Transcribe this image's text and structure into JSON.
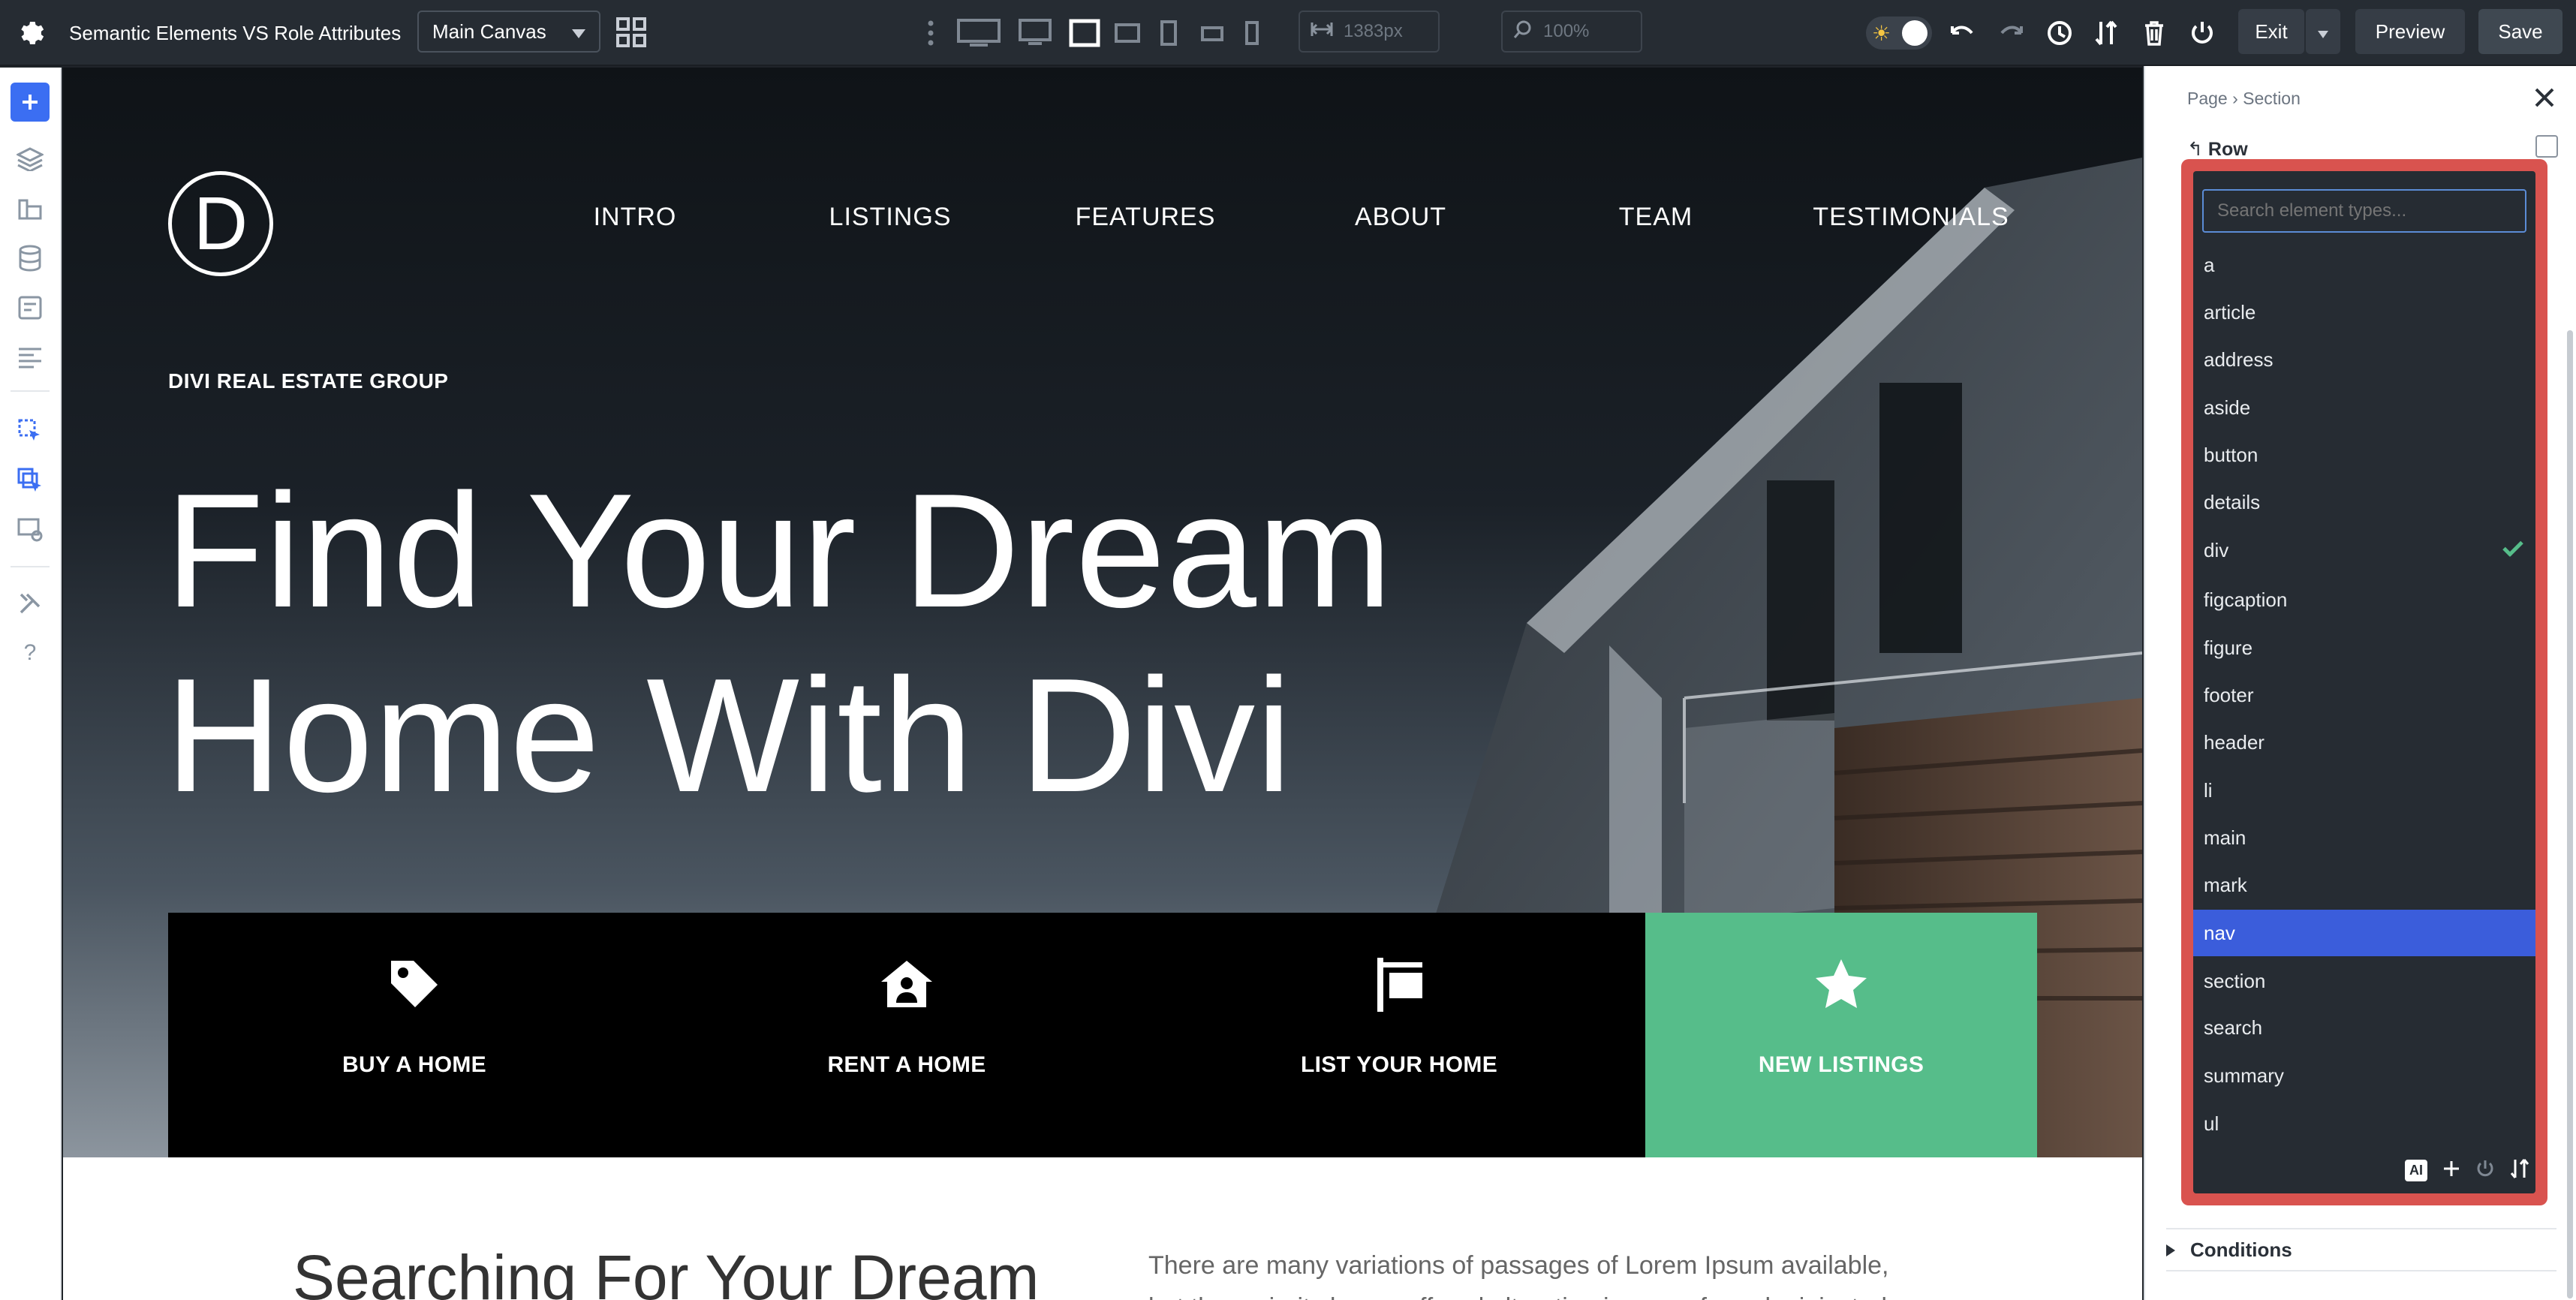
{
  "topbar": {
    "title": "Semantic Elements VS Role Attributes",
    "canvas_select": "Main Canvas",
    "width_field": "1383px",
    "zoom_field": "100%",
    "exit_label": "Exit",
    "preview_label": "Preview",
    "save_label": "Save"
  },
  "canvas": {
    "logo_letter": "D",
    "nav": [
      "INTRO",
      "LISTINGS",
      "FEATURES",
      "ABOUT",
      "TEAM",
      "TESTIMONIALS"
    ],
    "eyebrow": "DIVI REAL ESTATE GROUP",
    "hero_line1": "Find Your Dream",
    "hero_line2": "Home With Divi",
    "cards": [
      {
        "label": "BUY A HOME",
        "icon": "tag-icon"
      },
      {
        "label": "RENT A HOME",
        "icon": "house-user-icon"
      },
      {
        "label": "LIST YOUR HOME",
        "icon": "sign-icon"
      },
      {
        "label": "NEW LISTINGS",
        "icon": "star-icon"
      }
    ],
    "accent_color": "#56bd8a",
    "section_title": "Searching For Your Dream",
    "section_text": "There are many variations of passages of Lorem Ipsum available, but the majority have suffered alteration in some form, by injected"
  },
  "panel": {
    "breadcrumb_page": "Page",
    "breadcrumb_section": "Section",
    "row_label": "Row",
    "conditions_label": "Conditions"
  },
  "dropdown": {
    "search_placeholder": "Search element types...",
    "items": [
      "a",
      "article",
      "address",
      "aside",
      "button",
      "details",
      "div",
      "figcaption",
      "figure",
      "footer",
      "header",
      "li",
      "main",
      "mark",
      "nav",
      "section",
      "search",
      "summary",
      "ul"
    ],
    "checked_item": "div",
    "highlighted_item": "nav",
    "ai_label": "AI",
    "border_color": "#d9534f",
    "highlight_color": "#3b5ddb"
  }
}
